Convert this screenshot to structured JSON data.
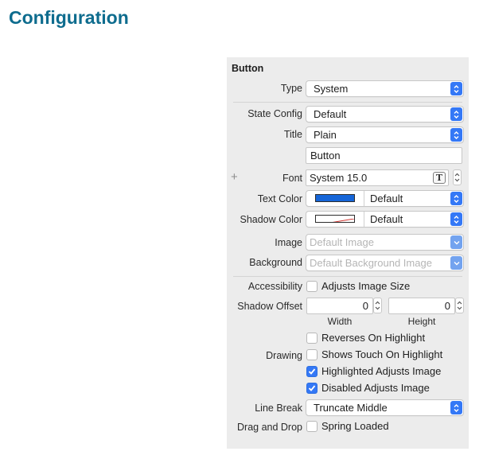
{
  "page_title": "Configuration",
  "section_title": "Button",
  "type": {
    "label": "Type",
    "value": "System"
  },
  "state_config": {
    "label": "State Config",
    "value": "Default"
  },
  "title_row": {
    "label": "Title",
    "value": "Plain",
    "text": "Button"
  },
  "font": {
    "label": "Font",
    "value": "System 15.0",
    "t_glyph": "T",
    "plus": "+"
  },
  "text_color": {
    "label": "Text Color",
    "value": "Default",
    "swatch": "#1565d8"
  },
  "shadow_color": {
    "label": "Shadow Color",
    "value": "Default"
  },
  "image": {
    "label": "Image",
    "placeholder": "Default Image"
  },
  "background": {
    "label": "Background",
    "placeholder": "Default Background Image"
  },
  "accessibility": {
    "label": "Accessibility",
    "option": "Adjusts Image Size",
    "checked": false
  },
  "shadow_offset": {
    "label": "Shadow Offset",
    "width": "0",
    "height": "0",
    "width_label": "Width",
    "height_label": "Height"
  },
  "drawing": {
    "label": "Drawing",
    "options": [
      {
        "label": "Reverses On Highlight",
        "checked": false
      },
      {
        "label": "Shows Touch On Highlight",
        "checked": false
      },
      {
        "label": "Highlighted Adjusts Image",
        "checked": true
      },
      {
        "label": "Disabled Adjusts Image",
        "checked": true
      }
    ]
  },
  "line_break": {
    "label": "Line Break",
    "value": "Truncate Middle"
  },
  "drag_and_drop": {
    "label": "Drag and Drop",
    "option": "Spring Loaded",
    "checked": false
  },
  "colors": {
    "accent": "#3478f6",
    "title": "#0e6c8e",
    "panel": "#ececec"
  }
}
